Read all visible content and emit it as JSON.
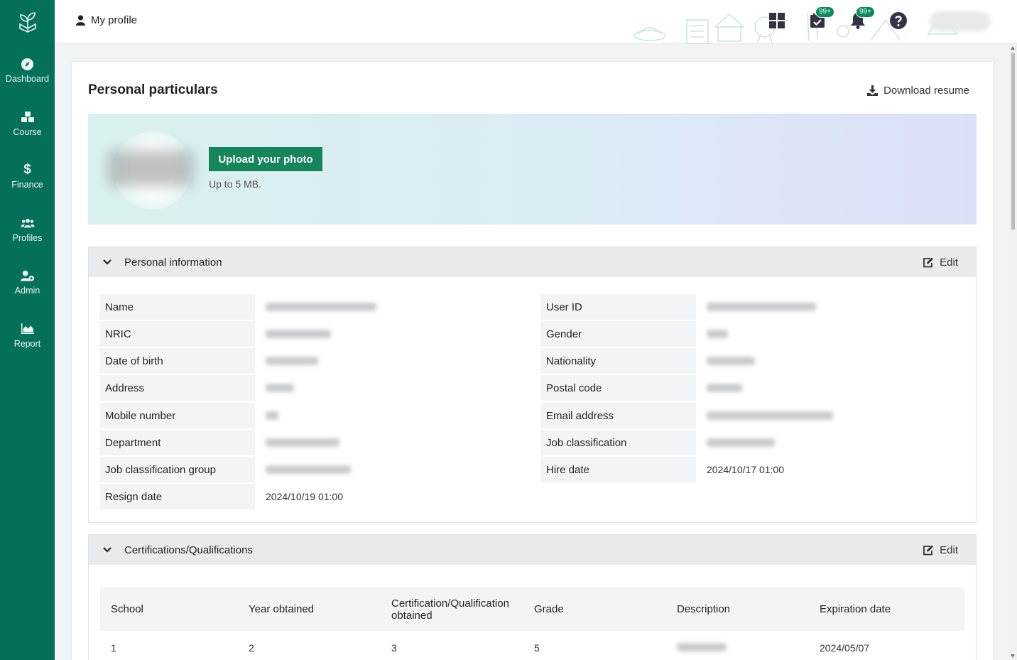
{
  "sidebar": {
    "items": [
      {
        "label": "Dashboard",
        "icon": "compass-icon"
      },
      {
        "label": "Course",
        "icon": "cubes-icon"
      },
      {
        "label": "Finance",
        "icon": "dollar-icon"
      },
      {
        "label": "Profiles",
        "icon": "users-icon"
      },
      {
        "label": "Admin",
        "icon": "user-gear-icon"
      },
      {
        "label": "Report",
        "icon": "area-chart-icon"
      }
    ],
    "bg_color": "#05705a"
  },
  "header": {
    "title": "My profile",
    "tasks_badge": "99+",
    "notifications_badge": "99+"
  },
  "page": {
    "title": "Personal particulars",
    "download_label": "Download resume",
    "upload_label": "Upload your photo",
    "upload_hint": "Up to 5 MB."
  },
  "personal": {
    "title": "Personal information",
    "edit_label": "Edit",
    "left": [
      {
        "key": "Name",
        "value": ""
      },
      {
        "key": "NRIC",
        "value": ""
      },
      {
        "key": "Date of birth",
        "value": ""
      },
      {
        "key": "Address",
        "value": ""
      },
      {
        "key": "Mobile number",
        "value": ""
      },
      {
        "key": "Department",
        "value": ""
      },
      {
        "key": "Job classification group",
        "value": ""
      },
      {
        "key": "Resign date",
        "value": "2024/10/19 01:00"
      }
    ],
    "right": [
      {
        "key": "User ID",
        "value": ""
      },
      {
        "key": "Gender",
        "value": ""
      },
      {
        "key": "Nationality",
        "value": ""
      },
      {
        "key": "Postal code",
        "value": ""
      },
      {
        "key": "Email address",
        "value": ""
      },
      {
        "key": "Job classification",
        "value": ""
      },
      {
        "key": "Hire date",
        "value": "2024/10/17 01:00"
      }
    ]
  },
  "certs": {
    "title": "Certifications/Qualifications",
    "edit_label": "Edit",
    "columns": [
      "School",
      "Year obtained",
      "Certification/Qualification obtained",
      "Grade",
      "Description",
      "Expiration date"
    ],
    "rows": [
      [
        "1",
        "2",
        "3",
        "5",
        "",
        "2024/05/07"
      ]
    ]
  },
  "colors": {
    "accent": "#16845c",
    "badge": "#0b8a5c"
  }
}
